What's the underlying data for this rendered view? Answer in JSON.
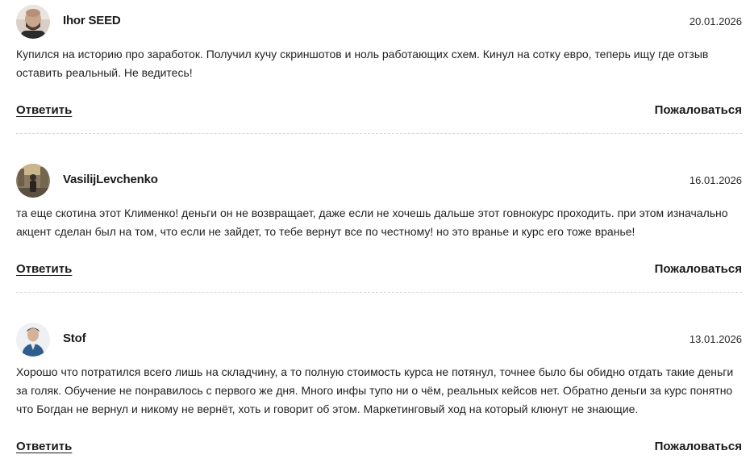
{
  "comments": [
    {
      "author": "Ihor SEED",
      "date": "20.01.2026",
      "text": "Купился на историю про заработок. Получил кучу скриншотов и ноль работающих схем. Кинул на сотку евро, теперь ищу где отзыв оставить реальный. Не ведитесь!",
      "reply_label": "Ответить",
      "report_label": "Пожаловаться",
      "avatar_icon": "user-avatar-bald-man"
    },
    {
      "author": "VasilijLevchenko",
      "date": "16.01.2026",
      "text": "та еще скотина этот Клименко! деньги он не возвращает, даже если не хочешь дальше этот говнокурс проходить. при этом изначально акцент сделан был на том, что если не зайдет, то тебе вернут все по честному! но это вранье и курс его тоже вранье!",
      "reply_label": "Ответить",
      "report_label": "Пожаловаться",
      "avatar_icon": "user-avatar-street-photo"
    },
    {
      "author": "Stof",
      "date": "13.01.2026",
      "text": "Хорошо что потратился всего лишь на складчину, а то полную стоимость курса не потянул, точнее было бы обидно отдать такие деньги за голяк. Обучение не понравилось с первого же дня. Много инфы тупо ни о чём, реальных кейсов нет. Обратно деньги за курс понятно что Богдан не вернул и никому не вернёт, хоть и говорит об этом. Маркетинговый ход на который клюнут не знающие.",
      "reply_label": "Ответить",
      "report_label": "Пожаловаться",
      "avatar_icon": "user-avatar-man-blue-jacket"
    }
  ]
}
